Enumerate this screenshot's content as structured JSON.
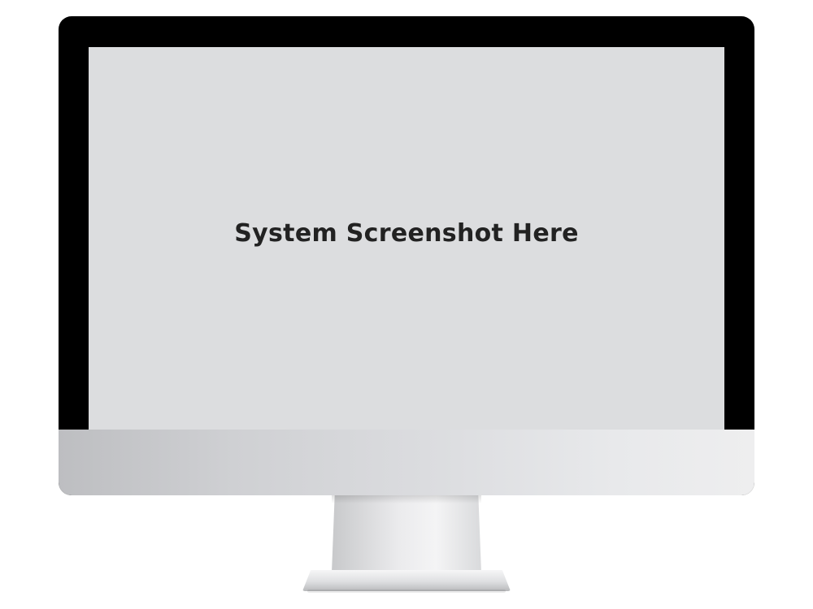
{
  "monitor": {
    "screen_text": "System Screenshot Here"
  },
  "colors": {
    "bezel": "#000000",
    "screen": "#dcdddf",
    "text": "#222222"
  }
}
